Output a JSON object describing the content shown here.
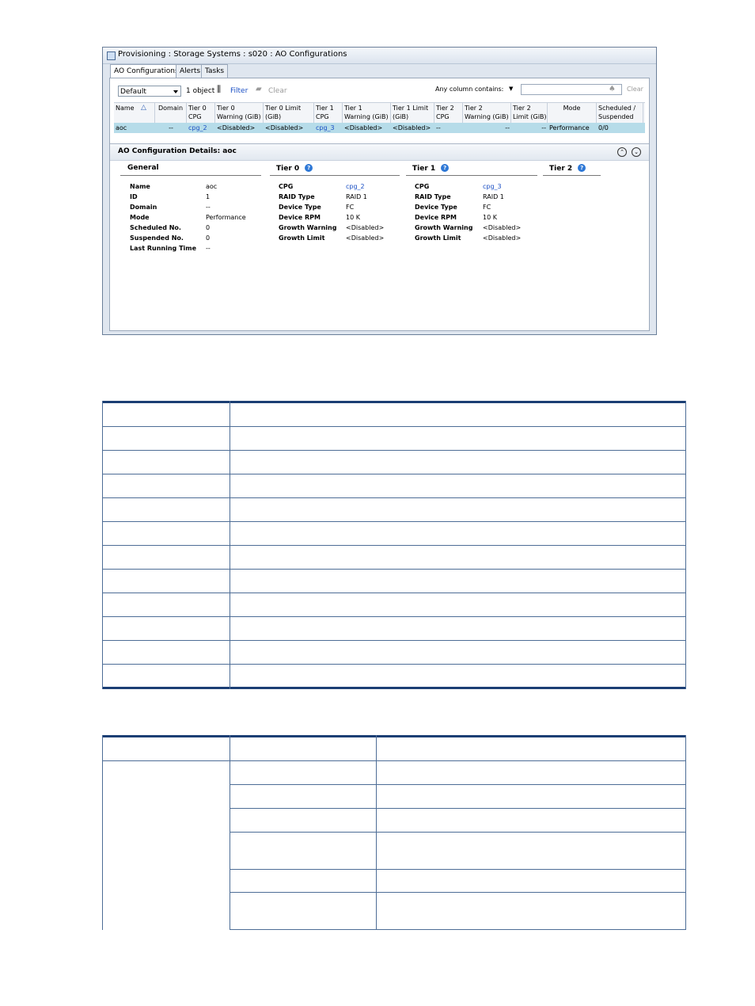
{
  "window": {
    "title": "Provisioning : Storage Systems : s020 : AO Configurations",
    "tabs": [
      {
        "label": "AO Configurations",
        "active": true
      },
      {
        "label": "Alerts",
        "active": false
      },
      {
        "label": "Tasks",
        "active": false
      }
    ],
    "toolbar": {
      "view_select": "Default",
      "object_count": "1 object",
      "filter_label": "Filter",
      "clear_label": "Clear",
      "search_label": "Any column contains:",
      "search_value": "",
      "search_clear": "Clear"
    },
    "grid": {
      "columns": [
        "Name",
        "Domain",
        "Tier 0 CPG",
        "Tier 0 Warning (GiB)",
        "Tier 0 Limit (GiB)",
        "Tier 1 CPG",
        "Tier 1 Warning (GiB)",
        "Tier 1 Limit (GiB)",
        "Tier 2 CPG",
        "Tier 2 Warning (GiB)",
        "Tier 2 Limit (GiB)",
        "Mode",
        "Scheduled / Suspended"
      ],
      "header_lines": [
        [
          "Name",
          ""
        ],
        [
          "Domain",
          ""
        ],
        [
          "Tier 0",
          "CPG"
        ],
        [
          "Tier 0",
          "Warning (GiB)"
        ],
        [
          "Tier 0 Limit",
          "(GiB)"
        ],
        [
          "Tier 1",
          "CPG"
        ],
        [
          "Tier 1",
          "Warning (GiB)"
        ],
        [
          "Tier 1 Limit",
          "(GiB)"
        ],
        [
          "Tier 2",
          "CPG"
        ],
        [
          "Tier 2",
          "Warning (GiB)"
        ],
        [
          "Tier 2",
          "Limit (GiB)"
        ],
        [
          "Mode",
          ""
        ],
        [
          "Scheduled /",
          "Suspended"
        ]
      ],
      "rows": [
        [
          "aoc",
          "--",
          "cpg_2",
          "<Disabled>",
          "<Disabled>",
          "cpg_3",
          "<Disabled>",
          "<Disabled>",
          "--",
          "--",
          "--",
          "Performance",
          "0/0"
        ]
      ],
      "selected_row_color": "#b6dce9"
    },
    "details": {
      "title": "AO Configuration Details: aoc",
      "general": {
        "header": "General",
        "items": [
          {
            "key": "Name",
            "value": "aoc"
          },
          {
            "key": "ID",
            "value": "1"
          },
          {
            "key": "Domain",
            "value": "--"
          },
          {
            "key": "Mode",
            "value": "Performance"
          },
          {
            "key": "Scheduled No.",
            "value": "0"
          },
          {
            "key": "Suspended No.",
            "value": "0"
          },
          {
            "key": "Last Running Time",
            "value": "--"
          }
        ]
      },
      "tier0": {
        "header": "Tier 0",
        "items": [
          {
            "key": "CPG",
            "value": "cpg_2"
          },
          {
            "key": "RAID Type",
            "value": "RAID 1"
          },
          {
            "key": "Device Type",
            "value": "FC"
          },
          {
            "key": "Device RPM",
            "value": "10 K"
          },
          {
            "key": "Growth Warning",
            "value": "<Disabled>"
          },
          {
            "key": "Growth Limit",
            "value": "<Disabled>"
          }
        ]
      },
      "tier1": {
        "header": "Tier 1",
        "items": [
          {
            "key": "CPG",
            "value": "cpg_3"
          },
          {
            "key": "RAID Type",
            "value": "RAID 1"
          },
          {
            "key": "Device Type",
            "value": "FC"
          },
          {
            "key": "Device RPM",
            "value": "10 K"
          },
          {
            "key": "Growth Warning",
            "value": "<Disabled>"
          },
          {
            "key": "Growth Limit",
            "value": "<Disabled>"
          }
        ]
      },
      "tier2": {
        "header": "Tier 2"
      }
    }
  },
  "colors": {
    "link": "#1a4fc4",
    "table_rule": "#1c3f74",
    "help_icon": "#2e78d6"
  }
}
